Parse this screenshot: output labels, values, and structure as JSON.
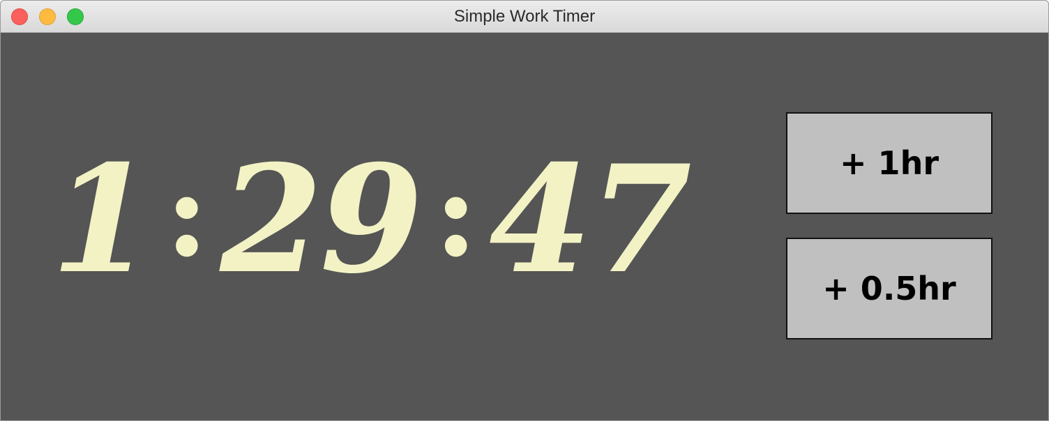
{
  "window": {
    "title": "Simple Work Timer"
  },
  "timer": {
    "hours": "1",
    "separator": ":",
    "minutes": "29",
    "seconds": "47"
  },
  "buttons": {
    "add_one_hour": "+ 1hr",
    "add_half_hour": "+ 0.5hr"
  },
  "colors": {
    "background": "#555555",
    "timer_text": "#f2f2c5",
    "button_bg": "#c0c0c0"
  }
}
